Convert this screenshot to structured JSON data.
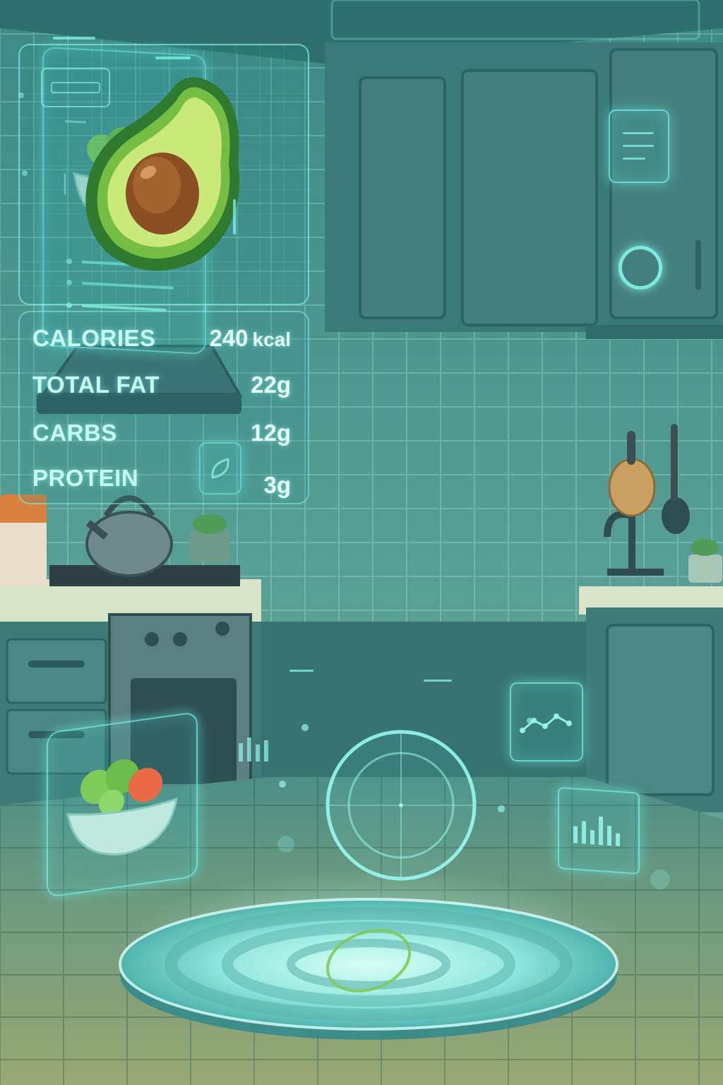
{
  "nutrition": {
    "rows": [
      {
        "label": "CALORIES",
        "value": "240",
        "unit": "kcal"
      },
      {
        "label": "TOTAL FAT",
        "value": "22g",
        "unit": ""
      },
      {
        "label": "CARBS",
        "value": "12g",
        "unit": ""
      },
      {
        "label": "PROTEIN",
        "value": "3g",
        "unit": ""
      }
    ]
  },
  "icons": {
    "main_food": "avocado-icon",
    "recipe_card": "salad-bowl-icon",
    "saved_meal": "salad-bowl-icon",
    "health_widget": "leaf-icon",
    "trend_widget": "line-graph-icon",
    "stats_widget": "bar-chart-icon",
    "scanner": "scan-target-icon",
    "platform": "hologram-projector-icon"
  },
  "colors": {
    "hologram": "#8cfaf0",
    "background": "#2c6b6c",
    "avocado_skin": "#2f7a2e",
    "avocado_flesh": "#c9e97a",
    "avocado_pit": "#8a4f22"
  }
}
